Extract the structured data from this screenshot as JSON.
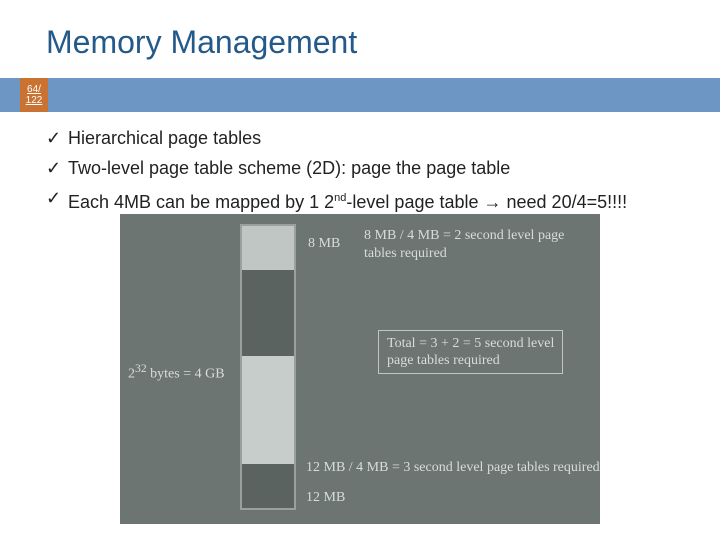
{
  "title": "Memory Management",
  "badge": {
    "top": "64/",
    "bot": "122"
  },
  "bullets": [
    "Hierarchical page tables",
    "Two-level page table scheme (2D): page the page table",
    ""
  ],
  "bullet3": {
    "a": "Each 4MB can be mapped by 1 2",
    "sup": "nd",
    "b": "-level page table ",
    "arrow": "→",
    "c": " need 20/4=5!!!!"
  },
  "check": "✓",
  "diagram": {
    "left_label_a": "2",
    "left_label_sup": "32",
    "left_label_b": " bytes = 4 GB",
    "top_inner": "8 MB",
    "top_right_l1": "8 MB / 4 MB = 2 second level page",
    "top_right_l2": "tables required",
    "mid_box_l1": "Total = 3 + 2 = 5 second level",
    "mid_box_l2": "page tables required",
    "bot_right": "12 MB / 4 MB = 3 second level page tables required",
    "bot_inner": "12 MB"
  }
}
